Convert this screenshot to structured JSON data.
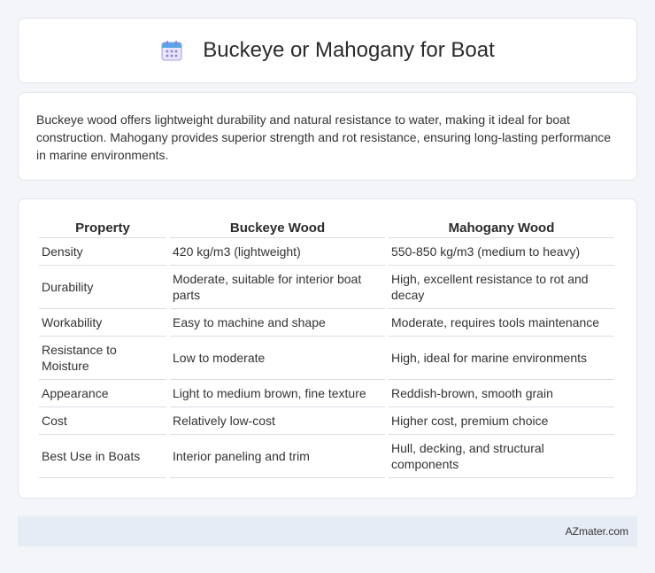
{
  "header": {
    "title": "Buckeye or Mahogany for Boat",
    "icon": "calendar-icon"
  },
  "intro": {
    "text": "Buckeye wood offers lightweight durability and natural resistance to water, making it ideal for boat construction. Mahogany provides superior strength and rot resistance, ensuring long-lasting performance in marine environments."
  },
  "table": {
    "headers": [
      "Property",
      "Buckeye Wood",
      "Mahogany Wood"
    ],
    "rows": [
      [
        "Density",
        "420 kg/m3 (lightweight)",
        "550-850 kg/m3 (medium to heavy)"
      ],
      [
        "Durability",
        "Moderate, suitable for interior boat parts",
        "High, excellent resistance to rot and decay"
      ],
      [
        "Workability",
        "Easy to machine and shape",
        "Moderate, requires tools maintenance"
      ],
      [
        "Resistance to Moisture",
        "Low to moderate",
        "High, ideal for marine environments"
      ],
      [
        "Appearance",
        "Light to medium brown, fine texture",
        "Reddish-brown, smooth grain"
      ],
      [
        "Cost",
        "Relatively low-cost",
        "Higher cost, premium choice"
      ],
      [
        "Best Use in Boats",
        "Interior paneling and trim",
        "Hull, decking, and structural components"
      ]
    ]
  },
  "footer": {
    "source": "AZmater.com"
  },
  "colors": {
    "background": "#f3f5f9",
    "card": "#ffffff",
    "footer_bar": "#e6ecf5",
    "icon_purple": "#8b7fd6",
    "icon_blue": "#5aa6e8"
  }
}
